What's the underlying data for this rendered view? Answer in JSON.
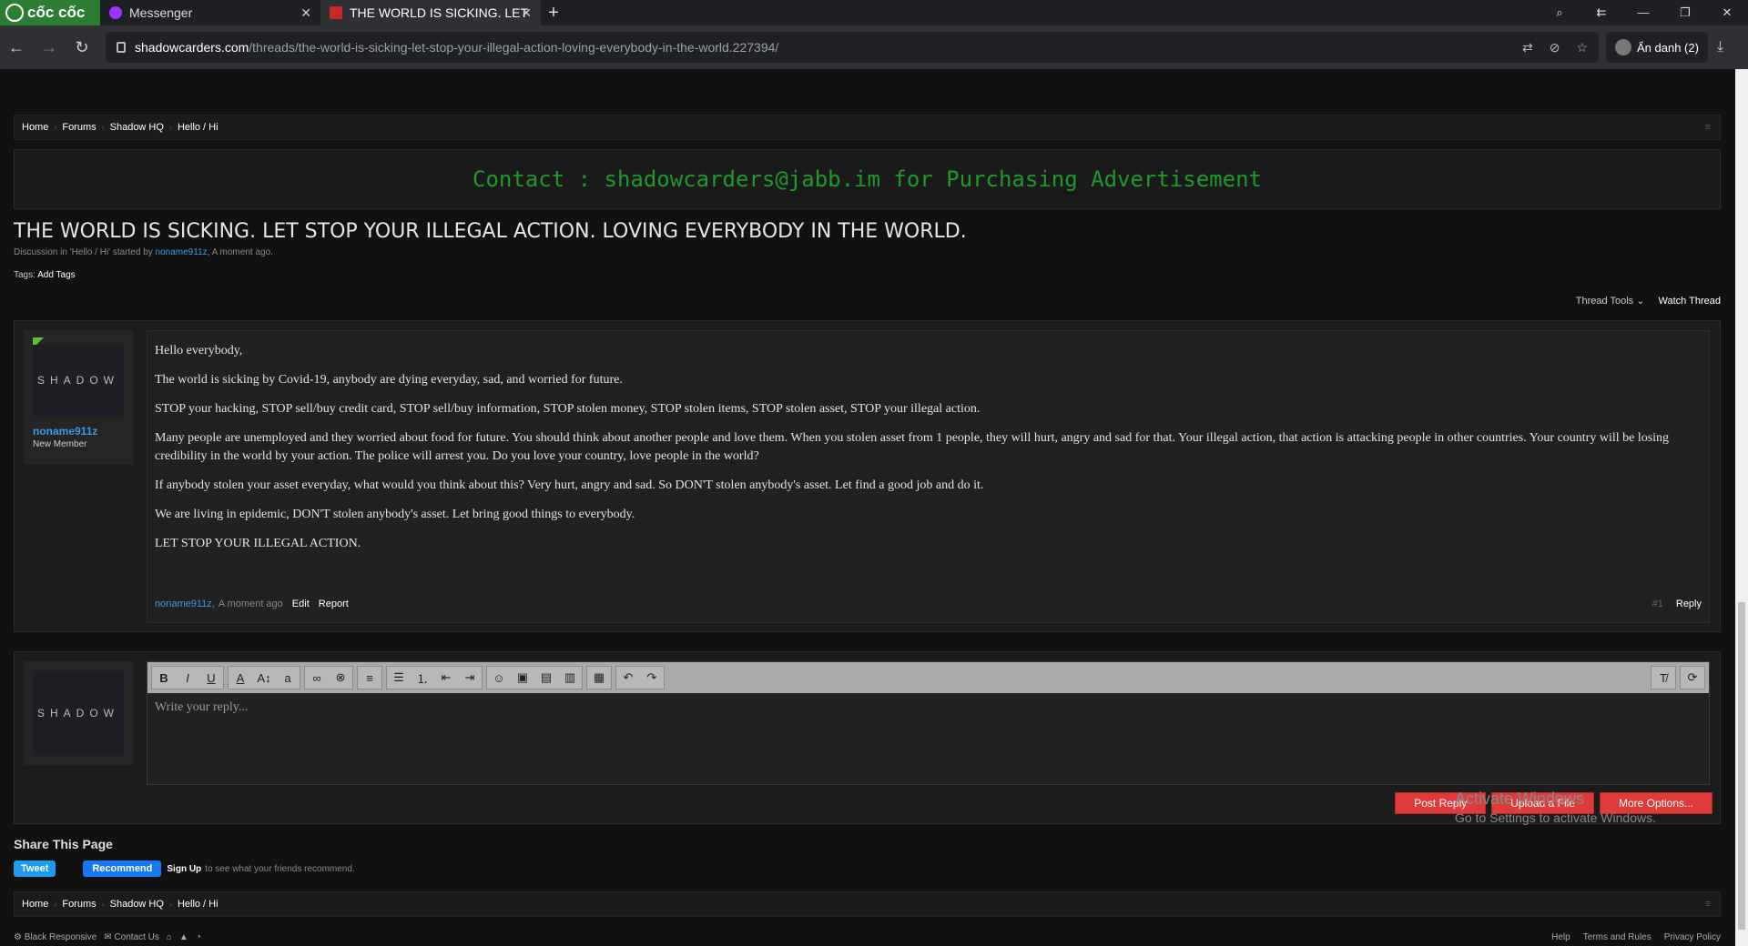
{
  "browser": {
    "brand": "cốc cốc",
    "tabs": [
      {
        "label": "Messenger"
      },
      {
        "label": "THE WORLD IS SICKING. LET"
      }
    ],
    "url_host": "shadowcarders.com",
    "url_path": "/threads/the-world-is-sicking-let-stop-your-illegal-action-loving-everybody-in-the-world.227394/",
    "profile": "Ẩn danh (2)"
  },
  "breadcrumb": [
    "Home",
    "Forums",
    "Shadow HQ",
    "Hello / Hi"
  ],
  "ad_text": "Contact : shadowcarders@jabb.im for Purchasing Advertisement",
  "thread": {
    "title": "THE WORLD IS SICKING. LET STOP YOUR ILLEGAL ACTION. LOVING EVERYBODY IN THE WORLD.",
    "meta_prefix": "Discussion in 'Hello / Hi' started by",
    "author": "noname911z",
    "meta_suffix": ", A moment ago.",
    "tags_label": "Tags:",
    "tags_link": "Add Tags",
    "thread_tools": "Thread Tools ⌄",
    "watch_thread": "Watch Thread"
  },
  "post": {
    "avatar_text": "SHADOW",
    "username": "noname911z",
    "role": "New Member",
    "paragraphs": [
      "Hello everybody,",
      "The world is sicking by Covid-19, anybody are dying everyday, sad, and worried for future.",
      "STOP your hacking, STOP sell/buy credit card, STOP sell/buy information, STOP stolen money, STOP stolen items, STOP stolen asset, STOP your illegal action.",
      "Many people are unemployed and they worried about food for future. You should think about another people and love them. When you stolen asset from 1 people, they will hurt, angry and sad for that. Your illegal action, that action is attacking people in other countries. Your country will be losing credibility in the world by your action. The police will arrest you. Do you love your country, love people in the world?",
      "If anybody stolen your asset everyday, what would you think about this? Very hurt, angry and sad. So DON'T stolen anybody's asset. Let find a good job and do it.",
      "We are living in epidemic, DON'T stolen anybody's asset. Let bring good things to everybody.",
      "LET STOP YOUR ILLEGAL ACTION."
    ],
    "footer_author": "noname911z,",
    "footer_time": "A moment ago",
    "edit": "Edit",
    "report": "Report",
    "number": "#1",
    "reply": "Reply"
  },
  "reply": {
    "avatar_text": "SHADOW",
    "placeholder": "Write your reply...",
    "post_reply": "Post Reply",
    "upload": "Upload a File",
    "more": "More Options..."
  },
  "share": {
    "title": "Share This Page",
    "tweet": "Tweet",
    "recommend": "Recommend",
    "signup": "Sign Up",
    "signup_text": "to see what your friends recommend."
  },
  "footer": {
    "left1": "Black Responsive",
    "left2": "Contact Us",
    "right": [
      "Help",
      "Terms and Rules",
      "Privacy Policy"
    ]
  },
  "activate": {
    "title": "Activate Windows",
    "sub": "Go to Settings to activate Windows."
  }
}
